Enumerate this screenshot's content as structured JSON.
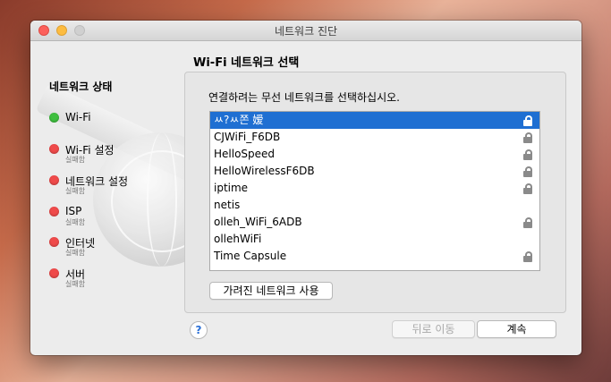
{
  "window": {
    "title": "네트워크 진단"
  },
  "sidebar": {
    "title": "네트워크 상태",
    "steps": [
      {
        "label": "Wi-Fi",
        "status": "",
        "color": "#3fbf3f"
      },
      {
        "label": "Wi-Fi 설정",
        "status": "실패함",
        "color": "#ef4a4a"
      },
      {
        "label": "네트워크 설정",
        "status": "실패함",
        "color": "#ef4a4a"
      },
      {
        "label": "ISP",
        "status": "실패함",
        "color": "#ef4a4a"
      },
      {
        "label": "인터넷",
        "status": "실패함",
        "color": "#ef4a4a"
      },
      {
        "label": "서버",
        "status": "실패함",
        "color": "#ef4a4a"
      }
    ]
  },
  "main": {
    "section_title": "Wi-Fi 네트워크 선택",
    "instruction": "연결하려는 무선 네트워크를 선택하십시오.",
    "networks": [
      {
        "name": "ㅆ?ㅆ쫀 嫒",
        "locked": true,
        "selected": true
      },
      {
        "name": "CJWiFi_F6DB",
        "locked": true,
        "selected": false
      },
      {
        "name": "HelloSpeed",
        "locked": true,
        "selected": false
      },
      {
        "name": "HelloWirelessF6DB",
        "locked": true,
        "selected": false
      },
      {
        "name": "iptime",
        "locked": true,
        "selected": false
      },
      {
        "name": "netis",
        "locked": false,
        "selected": false
      },
      {
        "name": "olleh_WiFi_6ADB",
        "locked": true,
        "selected": false
      },
      {
        "name": "ollehWiFi",
        "locked": false,
        "selected": false
      },
      {
        "name": "Time Capsule",
        "locked": true,
        "selected": false
      }
    ],
    "hidden_network_label": "가려진 네트워크 사용"
  },
  "footer": {
    "help_label": "?",
    "back_label": "뒤로 이동",
    "continue_label": "계속"
  },
  "colors": {
    "selection": "#1f6fd2",
    "ok": "#3fbf3f",
    "fail": "#ef4a4a"
  }
}
